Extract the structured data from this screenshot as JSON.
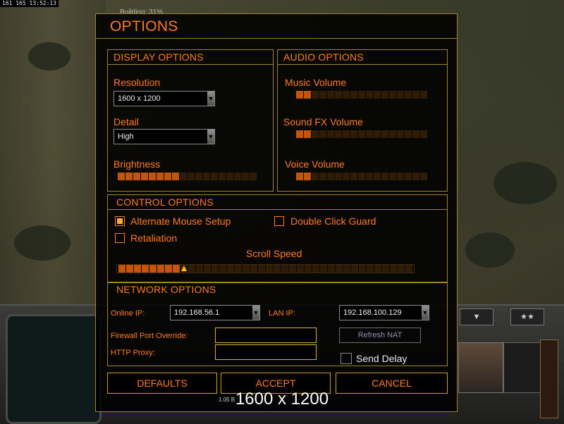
{
  "hud": {
    "status_text": "161 165 13:52:13",
    "building_text": "Building: 31%"
  },
  "dialog": {
    "title": "OPTIONS",
    "display": {
      "header": "DISPLAY OPTIONS",
      "resolution_label": "Resolution",
      "resolution_value": "1600 x 1200",
      "detail_label": "Detail",
      "detail_value": "High",
      "brightness_label": "Brightness",
      "brightness_level": "8 / 18"
    },
    "audio": {
      "header": "AUDIO OPTIONS",
      "music_label": "Music Volume",
      "music_level": "2 / 17",
      "sfx_label": "Sound FX Volume",
      "sfx_level": "2 / 17",
      "voice_label": "Voice Volume",
      "voice_level": "2 / 17"
    },
    "control": {
      "header": "CONTROL OPTIONS",
      "alt_mouse_label": "Alternate Mouse Setup",
      "alt_mouse_checked": true,
      "double_click_label": "Double Click Guard",
      "double_click_checked": false,
      "retaliation_label": "Retaliation",
      "retaliation_checked": false,
      "scroll_speed_label": "Scroll Speed",
      "scroll_speed_level": "8 / 38"
    },
    "network": {
      "header": "NETWORK OPTIONS",
      "online_ip_label": "Online IP:",
      "online_ip_value": "192.168.56.1",
      "lan_ip_label": "LAN IP:",
      "lan_ip_value": "192.168.100.129",
      "firewall_label": "Firewall Port Override:",
      "firewall_value": "",
      "proxy_label": "HTTP Proxy:",
      "proxy_value": "",
      "refresh_nat_label": "Refresh NAT",
      "send_delay_label": "Send Delay",
      "send_delay_checked": false
    },
    "buttons": {
      "defaults": "DEFAULTS",
      "accept": "ACCEPT",
      "cancel": "CANCEL"
    },
    "version_text": "1.05 B",
    "resolution_overlay": "1600 x 1200"
  },
  "colors": {
    "accent": "#ff7a21",
    "frame": "#a08428",
    "slider_on": "#c4540a",
    "slider_off": "#2e1c07"
  }
}
